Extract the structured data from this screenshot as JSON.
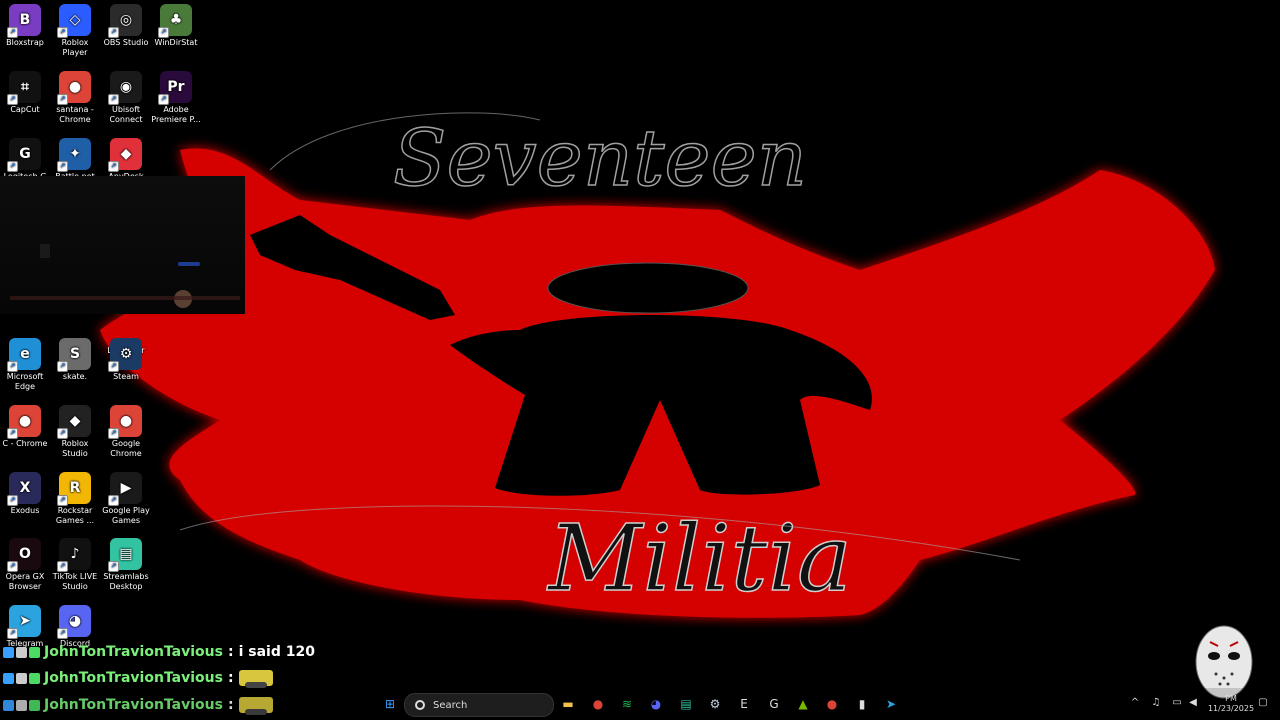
{
  "wallpaper": {
    "top_text": "Seventeen",
    "bottom_text": "Militia",
    "colors": {
      "background": "#000000",
      "splash": "#e10000",
      "figure": "#000000"
    }
  },
  "desktop_icons": [
    {
      "label": "Bloxstrap",
      "icon": "bloxstrap-icon",
      "color": "#7a3cc2",
      "glyph": "B"
    },
    {
      "label": "Roblox Player",
      "icon": "roblox-icon",
      "color": "#2a5cff",
      "glyph": "◇"
    },
    {
      "label": "OBS Studio",
      "icon": "obs-icon",
      "color": "#2b2b2b",
      "glyph": "◎"
    },
    {
      "label": "WinDirStat",
      "icon": "windirstat-icon",
      "color": "#4a7a3a",
      "glyph": "♣"
    },
    {
      "label": "CapCut",
      "icon": "capcut-icon",
      "color": "#111111",
      "glyph": "⌗"
    },
    {
      "label": "santana - Chrome",
      "icon": "chrome-icon",
      "color": "#db4437",
      "glyph": "●"
    },
    {
      "label": "Ubisoft Connect",
      "icon": "ubisoft-icon",
      "color": "#1a1a1a",
      "glyph": "◉"
    },
    {
      "label": "Adobe Premiere P...",
      "icon": "premiere-icon",
      "color": "#2a0a3a",
      "glyph": "Pr"
    },
    {
      "label": "Logitech G HUB",
      "icon": "logitech-icon",
      "color": "#111111",
      "glyph": "G"
    },
    {
      "label": "Battle.net",
      "icon": "battlenet-icon",
      "color": "#1e5fa8",
      "glyph": "✦"
    },
    {
      "label": "AnyDesk",
      "icon": "anydesk-icon",
      "color": "#e0303a",
      "glyph": "◆"
    },
    {
      "label": "Launcher",
      "icon": "launcher-icon",
      "color": "#1a1a1a",
      "glyph": "▣"
    },
    {
      "label": "Microsoft Edge",
      "icon": "edge-icon",
      "color": "#1f8fd6",
      "glyph": "e"
    },
    {
      "label": "skate.",
      "icon": "skate-icon",
      "color": "#6b6b6b",
      "glyph": "S"
    },
    {
      "label": "Steam",
      "icon": "steam-icon",
      "color": "#1b3a64",
      "glyph": "⚙"
    },
    {
      "label": "C - Chrome",
      "icon": "chrome-icon",
      "color": "#db4437",
      "glyph": "●"
    },
    {
      "label": "Roblox Studio",
      "icon": "roblox-studio-icon",
      "color": "#222222",
      "glyph": "◆"
    },
    {
      "label": "Google Chrome",
      "icon": "chrome-icon",
      "color": "#db4437",
      "glyph": "●"
    },
    {
      "label": "Exodus",
      "icon": "exodus-icon",
      "color": "#2a2a5a",
      "glyph": "X"
    },
    {
      "label": "Rockstar Games ...",
      "icon": "rockstar-icon",
      "color": "#f2b705",
      "glyph": "R"
    },
    {
      "label": "Google Play Games",
      "icon": "play-games-icon",
      "color": "#1a1a1a",
      "glyph": "▶"
    },
    {
      "label": "Opera GX Browser",
      "icon": "opera-gx-icon",
      "color": "#1a0a10",
      "glyph": "O"
    },
    {
      "label": "TikTok LIVE Studio",
      "icon": "tiktok-icon",
      "color": "#111111",
      "glyph": "♪"
    },
    {
      "label": "Streamlabs Desktop",
      "icon": "streamlabs-icon",
      "color": "#31c3a2",
      "glyph": "▤"
    },
    {
      "label": "Telegram",
      "icon": "telegram-icon",
      "color": "#2aa3df",
      "glyph": "➤"
    },
    {
      "label": "Discord",
      "icon": "discord-icon",
      "color": "#5865f2",
      "glyph": "◕"
    }
  ],
  "chat": [
    {
      "user": "JohnTonTravionTavious",
      "message": "i said 120",
      "emote": false
    },
    {
      "user": "JohnTonTravionTavious",
      "message": "",
      "emote": true
    },
    {
      "user": "JohnTonTravionTavious",
      "message": "",
      "emote": true
    }
  ],
  "taskbar": {
    "search_label": "Search",
    "apps": [
      {
        "icon": "start-icon",
        "glyph": "⊞",
        "color": "#3aa0ff"
      },
      {
        "icon": "file-explorer-icon",
        "glyph": "▬",
        "color": "#f2c14e"
      },
      {
        "icon": "chrome-icon",
        "glyph": "●",
        "color": "#db4437"
      },
      {
        "icon": "spotify-icon",
        "glyph": "≋",
        "color": "#1db954"
      },
      {
        "icon": "discord-icon",
        "glyph": "◕",
        "color": "#5865f2"
      },
      {
        "icon": "streamlabs-icon",
        "glyph": "▤",
        "color": "#31c3a2"
      },
      {
        "icon": "steam-icon",
        "glyph": "⚙",
        "color": "#c7d5e0"
      },
      {
        "icon": "epic-games-icon",
        "glyph": "E",
        "color": "#dddddd"
      },
      {
        "icon": "logitech-icon",
        "glyph": "G",
        "color": "#dddddd"
      },
      {
        "icon": "nvidia-icon",
        "glyph": "▲",
        "color": "#76b900"
      },
      {
        "icon": "chrome-icon",
        "glyph": "●",
        "color": "#db4437"
      },
      {
        "icon": "audio-meter-icon",
        "glyph": "▮",
        "color": "#dddddd"
      },
      {
        "icon": "telegram-icon",
        "glyph": "➤",
        "color": "#2aa3df"
      }
    ],
    "tray": [
      {
        "icon": "chevron-up-icon",
        "glyph": "^"
      },
      {
        "icon": "microphone-icon",
        "glyph": "♫"
      },
      {
        "icon": "network-icon",
        "glyph": "▭"
      },
      {
        "icon": "volume-icon",
        "glyph": "◀"
      },
      {
        "icon": "notification-icon",
        "glyph": "▢"
      }
    ],
    "clock": {
      "time": "PM",
      "date": "11/23/2025"
    }
  }
}
